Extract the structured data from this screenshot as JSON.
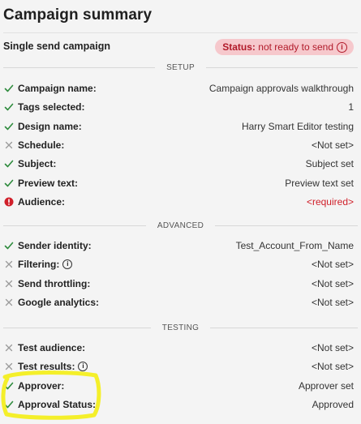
{
  "title": "Campaign summary",
  "subtitle": "Single send campaign",
  "status": {
    "label": "Status:",
    "value": "not ready to send",
    "color": "#b11a2a",
    "bg": "#f6c8cc"
  },
  "colors": {
    "ok": "#2e8b3d",
    "na": "#9a9a9a",
    "error": "#d0202a",
    "highlight": "#f4ef2a"
  },
  "sections": {
    "setup": "SETUP",
    "advanced": "ADVANCED",
    "testing": "TESTING"
  },
  "setup_rows": [
    {
      "label": "Campaign name:",
      "value": "Campaign approvals walkthrough",
      "state": "ok"
    },
    {
      "label": "Tags selected:",
      "value": "1",
      "state": "ok"
    },
    {
      "label": "Design name:",
      "value": "Harry Smart Editor testing",
      "state": "ok"
    },
    {
      "label": "Schedule:",
      "value": "<Not set>",
      "state": "na"
    },
    {
      "label": "Subject:",
      "value": "Subject set",
      "state": "ok"
    },
    {
      "label": "Preview text:",
      "value": "Preview text set",
      "state": "ok"
    },
    {
      "label": "Audience:",
      "value": "<required>",
      "state": "error"
    }
  ],
  "advanced_rows": [
    {
      "label": "Sender identity:",
      "value": "Test_Account_From_Name",
      "state": "ok"
    },
    {
      "label": "Filtering:",
      "value": "<Not set>",
      "state": "na",
      "info": true
    },
    {
      "label": "Send throttling:",
      "value": "<Not set>",
      "state": "na"
    },
    {
      "label": "Google analytics:",
      "value": "<Not set>",
      "state": "na"
    }
  ],
  "testing_rows": [
    {
      "label": "Test audience:",
      "value": "<Not set>",
      "state": "na"
    },
    {
      "label": "Test results:",
      "value": "<Not set>",
      "state": "na",
      "info": true
    },
    {
      "label": "Approver:",
      "value": "Approver set",
      "state": "ok"
    },
    {
      "label": "Approval Status:",
      "value": "Approved",
      "state": "ok"
    }
  ]
}
